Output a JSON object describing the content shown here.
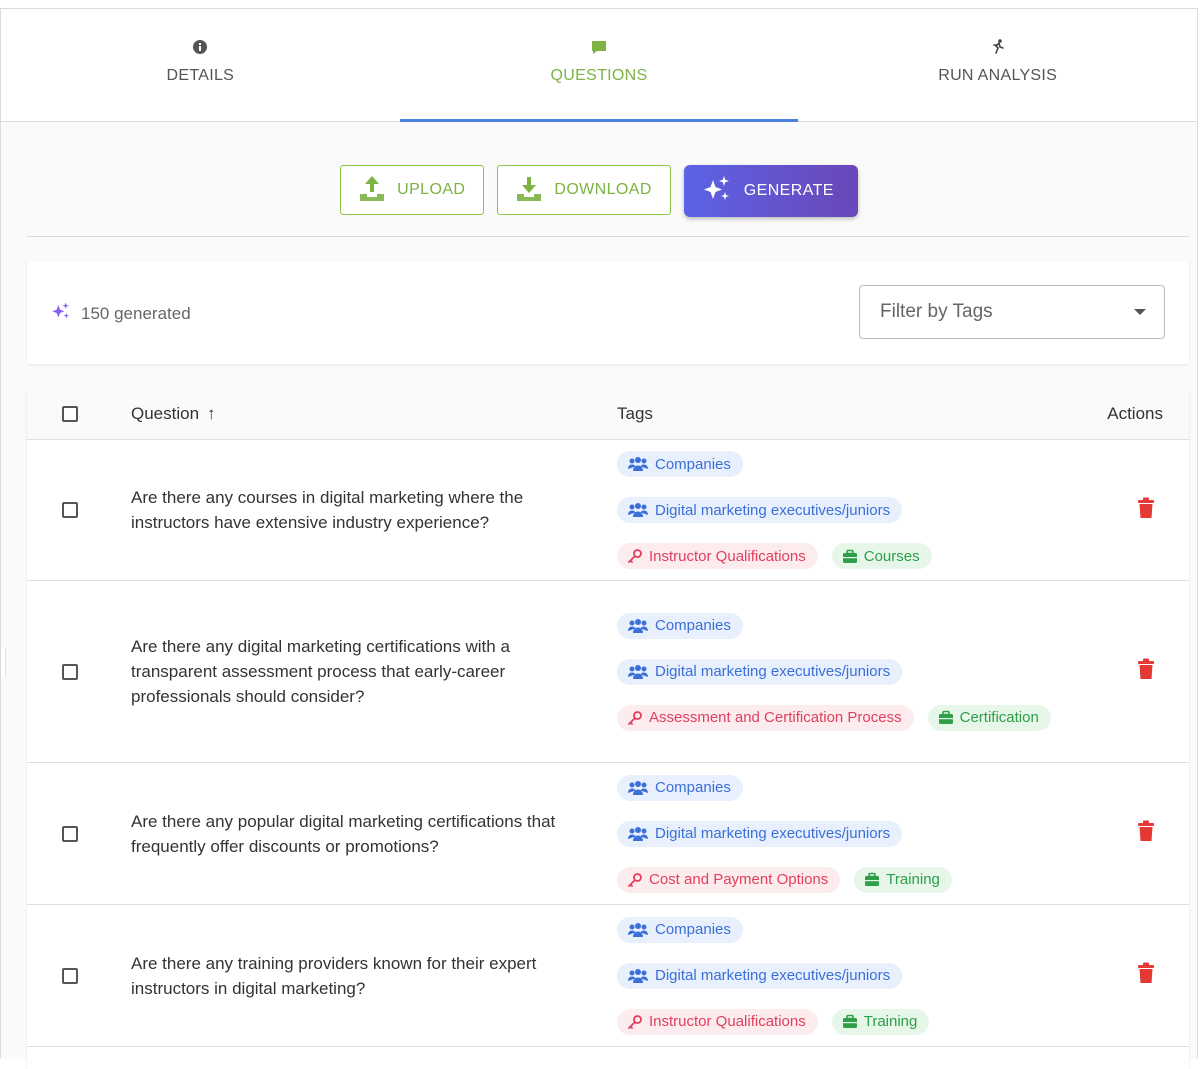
{
  "tabs": [
    {
      "label": "DETAILS",
      "icon": "info-circle-icon"
    },
    {
      "label": "QUESTIONS",
      "icon": "chat-bubble-icon"
    },
    {
      "label": "RUN ANALYSIS",
      "icon": "running-person-icon"
    }
  ],
  "toolbar": {
    "upload_label": "UPLOAD",
    "download_label": "DOWNLOAD",
    "generate_label": "GENERATE"
  },
  "filter": {
    "generated_count": "150 generated",
    "select_placeholder": "Filter by Tags"
  },
  "table": {
    "headers": {
      "question": "Question",
      "sort_indicator": "↑",
      "tags": "Tags",
      "actions": "Actions"
    },
    "rows": [
      {
        "question": "Are there any courses in digital marketing where the instructors have extensive industry experience?",
        "tags": [
          {
            "label": "Companies",
            "kind": "blue"
          },
          {
            "label": "Digital marketing executives/juniors",
            "kind": "blue"
          },
          {
            "label": "Instructor Qualifications",
            "kind": "pink"
          },
          {
            "label": "Courses",
            "kind": "green"
          }
        ]
      },
      {
        "question": "Are there any digital marketing certifications with a transparent assessment process that early-career professionals should consider?",
        "tags": [
          {
            "label": "Companies",
            "kind": "blue"
          },
          {
            "label": "Digital marketing executives/juniors",
            "kind": "blue"
          },
          {
            "label": "Assessment and Certification Process",
            "kind": "pink"
          },
          {
            "label": "Certification",
            "kind": "green"
          }
        ]
      },
      {
        "question": "Are there any popular digital marketing certifications that frequently offer discounts or promotions?",
        "tags": [
          {
            "label": "Companies",
            "kind": "blue"
          },
          {
            "label": "Digital marketing executives/juniors",
            "kind": "blue"
          },
          {
            "label": "Cost and Payment Options",
            "kind": "pink"
          },
          {
            "label": "Training",
            "kind": "green"
          }
        ]
      },
      {
        "question": "Are there any training providers known for their expert instructors in digital marketing?",
        "tags": [
          {
            "label": "Companies",
            "kind": "blue"
          },
          {
            "label": "Digital marketing executives/juniors",
            "kind": "blue"
          },
          {
            "label": "Instructor Qualifications",
            "kind": "pink"
          },
          {
            "label": "Training",
            "kind": "green"
          }
        ]
      }
    ]
  },
  "colors": {
    "accent_green": "#7cb342",
    "tab_indicator": "#4a7fe0",
    "generate_gradient": [
      "#5b63e6",
      "#6a47b8"
    ],
    "delete_red": "#e53935"
  }
}
